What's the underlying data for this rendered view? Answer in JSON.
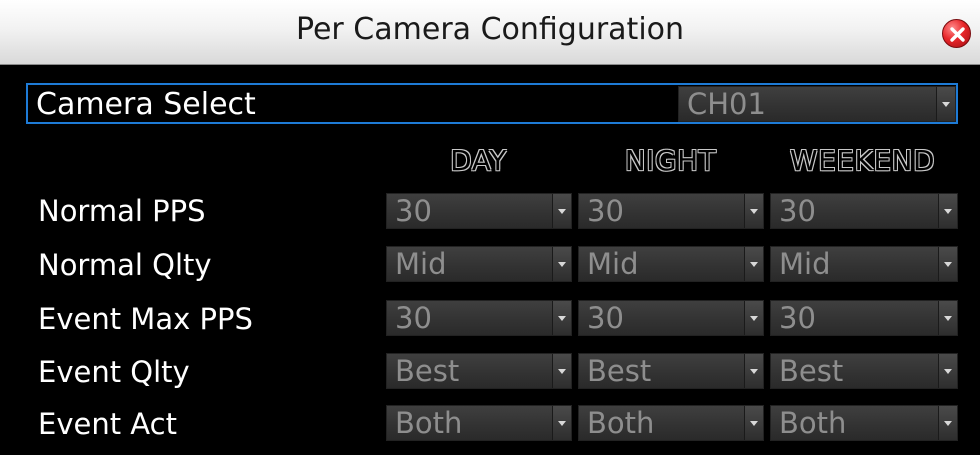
{
  "window": {
    "title": "Per Camera Configuration"
  },
  "camera_select": {
    "label": "Camera Select",
    "value": "CH01"
  },
  "columns": [
    "DAY",
    "NIGHT",
    "WEEKEND"
  ],
  "rows": [
    {
      "label": "Normal PPS",
      "values": [
        "30",
        "30",
        "30"
      ]
    },
    {
      "label": "Normal Qlty",
      "values": [
        "Mid",
        "Mid",
        "Mid"
      ]
    },
    {
      "label": "Event Max PPS",
      "values": [
        "30",
        "30",
        "30"
      ]
    },
    {
      "label": "Event Qlty",
      "values": [
        "Best",
        "Best",
        "Best"
      ]
    },
    {
      "label": "Event Act",
      "values": [
        "Both",
        "Both",
        "Both"
      ]
    }
  ],
  "colors": {
    "accent": "#1e7bd6",
    "close": "#e8262a",
    "dropdown_text": "#8e8e8e"
  }
}
